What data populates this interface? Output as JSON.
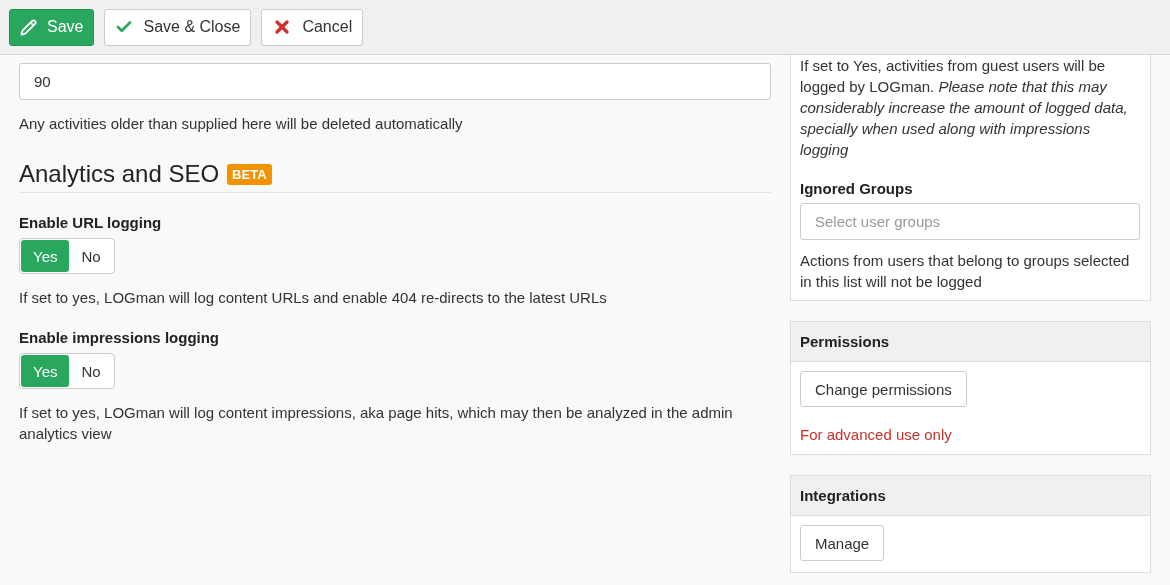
{
  "toolbar": {
    "buttons": [
      {
        "kind": "save",
        "label": "Save"
      },
      {
        "kind": "save_close",
        "label": "Save & Close"
      },
      {
        "kind": "cancel",
        "label": "Cancel"
      }
    ]
  },
  "main": {
    "retention_field": {
      "value": "90",
      "help": "Any activities older than supplied here will be deleted automatically"
    },
    "section": {
      "title": "Analytics and SEO",
      "badge": "BETA"
    },
    "toggles": [
      {
        "label": "Enable URL logging",
        "options": [
          {
            "label": "Yes",
            "selected": true
          },
          {
            "label": "No",
            "selected": false
          }
        ],
        "help": "If set to yes, LOGman will log content URLs and enable 404 re-directs to the latest URLs"
      },
      {
        "label": "Enable impressions logging",
        "options": [
          {
            "label": "Yes",
            "selected": true
          },
          {
            "label": "No",
            "selected": false
          }
        ],
        "help": "If set to yes, LOGman will log content impressions, aka page hits, which may then be analyzed in the admin analytics view"
      }
    ]
  },
  "sidebar": {
    "guest_help": "If set to Yes, activities from guest users will be logged by LOGman. *Please note that this may considerably increase the amount of logged data, specially when used along with impressions logging*",
    "ignored_groups": {
      "label": "Ignored Groups",
      "placeholder": "Select user groups",
      "help": "Actions from users that belong to groups selected in this list will not be logged"
    },
    "panels": [
      {
        "title": "Permissions",
        "button": "Change permissions",
        "note": "For advanced use only"
      },
      {
        "title": "Integrations",
        "button": "Manage"
      }
    ]
  }
}
